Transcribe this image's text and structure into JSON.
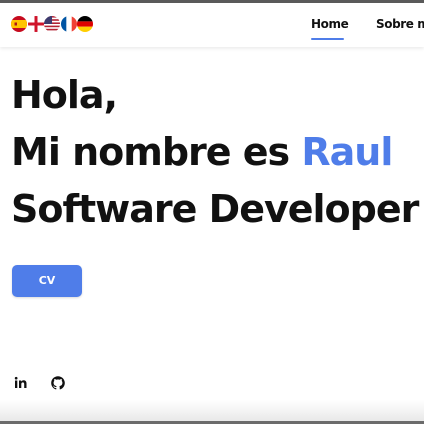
{
  "nav": {
    "languages": [
      "Español",
      "English (UK)",
      "English (US)",
      "Français",
      "Deutsch"
    ],
    "links": [
      {
        "label": "Home",
        "active": true
      },
      {
        "label": "Sobre mi",
        "active": false
      }
    ],
    "accent_color": "#4f7de9"
  },
  "hero": {
    "greeting": "Hola,",
    "intro_prefix": "Mi nombre es ",
    "name": "Raul",
    "role": "Software Developer"
  },
  "cv_button": {
    "label": "CV"
  },
  "social": {
    "icons": [
      "linkedin-icon",
      "github-icon"
    ]
  }
}
